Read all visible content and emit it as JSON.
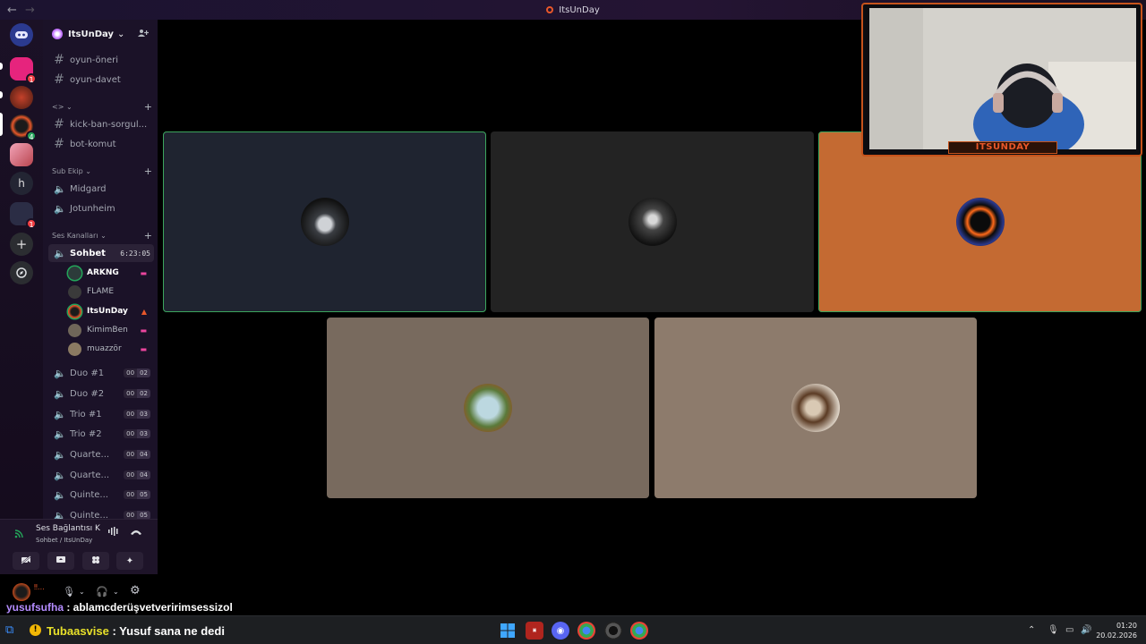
{
  "window": {
    "title": "ItsUnDay",
    "back": "←",
    "forward": "→"
  },
  "servers": [
    {
      "name": "dm-home-icon",
      "badge": ""
    },
    {
      "name": "server-pink",
      "badge": "1"
    },
    {
      "name": "server-red",
      "badge": ""
    },
    {
      "name": "server-itsunday",
      "badge": "4"
    },
    {
      "name": "server-anime",
      "badge": ""
    },
    {
      "name": "server-h",
      "label": "h",
      "badge": ""
    },
    {
      "name": "server-folder",
      "badge": "1"
    }
  ],
  "guild": {
    "name": "ItsUnDay",
    "chevron": "⌄",
    "add_icon": "+"
  },
  "text_channels": [
    {
      "name": "oyun-öneri"
    },
    {
      "name": "oyun-davet"
    }
  ],
  "categories": {
    "hidden": "<>",
    "sub_ekip": "Sub Ekip",
    "ses_kanallari": "Ses Kanalları"
  },
  "text_channels_2": [
    {
      "name": "kick-ban-sorgul..."
    },
    {
      "name": "bot-komut"
    }
  ],
  "sub_ekip_channels": [
    {
      "name": "Midgard"
    },
    {
      "name": "Jotunheim"
    }
  ],
  "active_voice": {
    "name": "Sohbet",
    "time": "6:23:05"
  },
  "voice_users": [
    {
      "name": "ARKNG",
      "streaming": true
    },
    {
      "name": "FLAME",
      "streaming": false
    },
    {
      "name": "ItsUnDay",
      "streaming": true
    },
    {
      "name": "KimimBen",
      "streaming": true
    },
    {
      "name": "muazzör",
      "streaming": true
    }
  ],
  "voice_channels": [
    {
      "name": "Duo #1",
      "a": "00",
      "b": "02"
    },
    {
      "name": "Duo #2",
      "a": "00",
      "b": "02"
    },
    {
      "name": "Trio #1",
      "a": "00",
      "b": "03"
    },
    {
      "name": "Trio #2",
      "a": "00",
      "b": "03"
    },
    {
      "name": "Quarte...",
      "a": "00",
      "b": "04"
    },
    {
      "name": "Quarte...",
      "a": "00",
      "b": "04"
    },
    {
      "name": "Quinte...",
      "a": "00",
      "b": "05"
    },
    {
      "name": "Quinte...",
      "a": "00",
      "b": "05"
    }
  ],
  "voice_panel": {
    "status": "Ses Bağlantısı K",
    "location": "Sohbet / ItsUnDay"
  },
  "stage": {
    "tiles": [
      {
        "name": "tile-arkng",
        "color": "#1f2430",
        "speaking": true
      },
      {
        "name": "tile-flame",
        "color": "#232323",
        "speaking": false
      },
      {
        "name": "tile-itsunday",
        "color": "#c46a32",
        "speaking": true
      },
      {
        "name": "tile-kimimben",
        "color": "#786a5e",
        "speaking": false
      },
      {
        "name": "tile-muazzor",
        "color": "#8d7b6c",
        "speaking": false
      }
    ]
  },
  "webcam": {
    "label": "ITSUNDAY"
  },
  "chat": [
    {
      "user": "yusufsufha",
      "text": " : ablamcderüşvetveririmsessizol"
    }
  ],
  "taskbar": {
    "alert_user": "Tubaasvise",
    "alert_text": " : Yusuf sana ne dedi",
    "time": "01:20",
    "date": "20.02.2026"
  }
}
